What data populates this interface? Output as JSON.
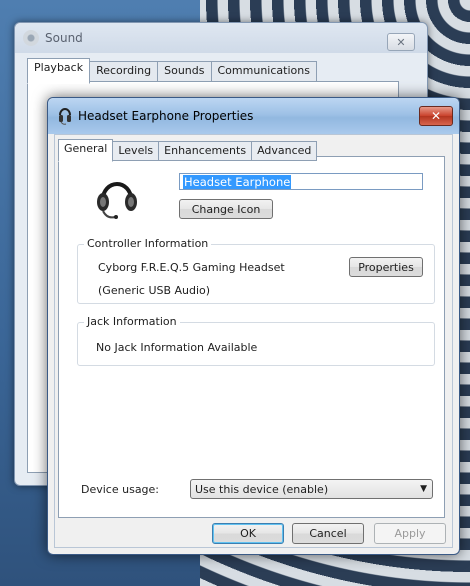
{
  "background_window": {
    "title": "Sound",
    "close_label": "✕",
    "tabs": [
      "Playback",
      "Recording",
      "Sounds",
      "Communications"
    ],
    "active_tab": "Playback"
  },
  "dialog": {
    "title": "Headset Earphone Properties",
    "close_label": "✕",
    "tabs": [
      "General",
      "Levels",
      "Enhancements",
      "Advanced"
    ],
    "active_tab": "General",
    "device_name_value": "Headset Earphone",
    "change_icon_label": "Change Icon",
    "controller": {
      "group_label": "Controller Information",
      "name": "Cyborg F.R.E.Q.5 Gaming Headset",
      "driver": "(Generic USB Audio)",
      "properties_label": "Properties"
    },
    "jack": {
      "group_label": "Jack Information",
      "text": "No Jack Information Available"
    },
    "device_usage": {
      "label": "Device usage:",
      "selected": "Use this device (enable)"
    },
    "buttons": {
      "ok": "OK",
      "cancel": "Cancel",
      "apply": "Apply"
    }
  },
  "icons": {
    "title_icon": "headset-icon",
    "device_icon": "headset-icon"
  },
  "colors": {
    "selection": "#3399ff",
    "close_red": "#c9412b",
    "titlebar_blue": "#9ec1e6"
  }
}
